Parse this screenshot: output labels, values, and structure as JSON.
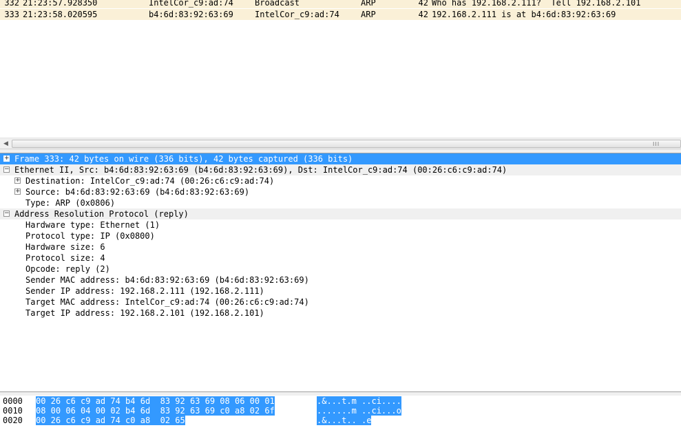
{
  "packets": [
    {
      "no": "332",
      "time": "21:23:57.928350",
      "source": "IntelCor_c9:ad:74",
      "destination": "Broadcast",
      "protocol": "ARP",
      "length": "42",
      "info": "Who has 192.168.2.111?  Tell 192.168.2.101"
    },
    {
      "no": "333",
      "time": "21:23:58.020595",
      "source": "b4:6d:83:92:63:69",
      "destination": "IntelCor_c9:ad:74",
      "protocol": "ARP",
      "length": "42",
      "info": "192.168.2.111 is at b4:6d:83:92:63:69"
    }
  ],
  "scrollbar": {
    "grip": "III"
  },
  "details": {
    "frame": "Frame 333: 42 bytes on wire (336 bits), 42 bytes captured (336 bits)",
    "ethernet": "Ethernet II, Src: b4:6d:83:92:63:69 (b4:6d:83:92:63:69), Dst: IntelCor_c9:ad:74 (00:26:c6:c9:ad:74)",
    "eth_destination": "Destination: IntelCor_c9:ad:74 (00:26:c6:c9:ad:74)",
    "eth_source": "Source: b4:6d:83:92:63:69 (b4:6d:83:92:63:69)",
    "eth_type": "Type: ARP (0x0806)",
    "arp": "Address Resolution Protocol (reply)",
    "arp_fields": [
      "Hardware type: Ethernet (1)",
      "Protocol type: IP (0x0800)",
      "Hardware size: 6",
      "Protocol size: 4",
      "Opcode: reply (2)",
      "Sender MAC address: b4:6d:83:92:63:69 (b4:6d:83:92:63:69)",
      "Sender IP address: 192.168.2.111 (192.168.2.111)",
      "Target MAC address: IntelCor_c9:ad:74 (00:26:c6:c9:ad:74)",
      "Target IP address: 192.168.2.101 (192.168.2.101)"
    ],
    "expand_collapsed": "+",
    "expand_open": "−"
  },
  "hex": [
    {
      "offset": "0000",
      "bytes": "00 26 c6 c9 ad 74 b4 6d  83 92 63 69 08 06 00 01",
      "ascii": ".&...t.m ..ci...."
    },
    {
      "offset": "0010",
      "bytes": "08 00 06 04 00 02 b4 6d  83 92 63 69 c0 a8 02 6f",
      "ascii": ".......m ..ci...o"
    },
    {
      "offset": "0020",
      "bytes": "00 26 c6 c9 ad 74 c0 a8  02 65",
      "ascii": ".&...t.. .e"
    }
  ],
  "colors": {
    "arp_row": "#faf0d7",
    "selection": "#3399ff"
  }
}
